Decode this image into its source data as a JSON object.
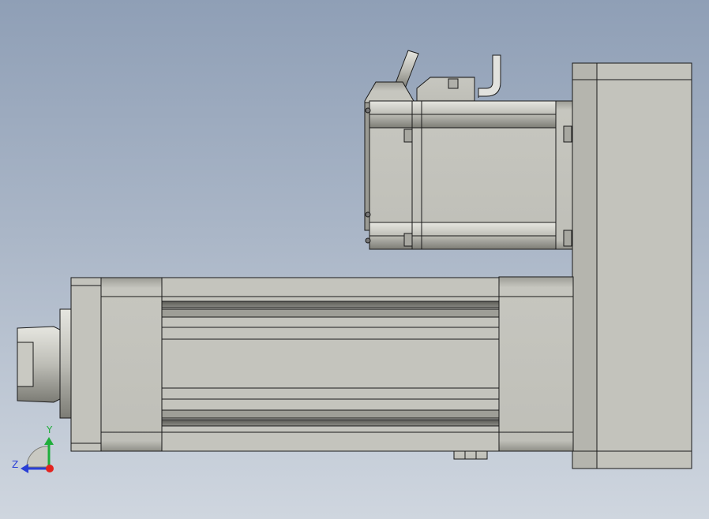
{
  "viewport": {
    "background_top": "#8f9fb6",
    "background_bottom": "#cfd6df"
  },
  "model": {
    "body_color": "#c2c2ba",
    "shade_color": "#8d8d85",
    "edge_color": "#1a1a1a",
    "cable_color": "#e2e2de"
  },
  "triad": {
    "y_label": "Y",
    "z_label": "Z",
    "y_color": "#1fae3a",
    "z_color": "#2a3fd6",
    "x_color": "#e3231f"
  }
}
